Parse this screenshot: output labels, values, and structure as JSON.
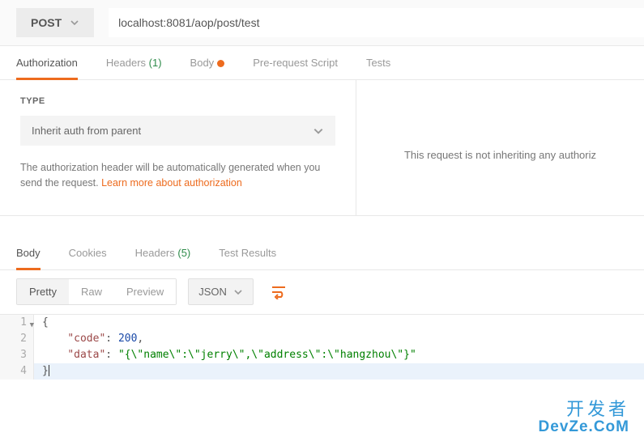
{
  "request": {
    "method": "POST",
    "url": "localhost:8081/aop/post/test"
  },
  "request_tabs": {
    "authorization": "Authorization",
    "headers": {
      "label": "Headers",
      "count": "(1)"
    },
    "body": "Body",
    "prerequest": "Pre-request Script",
    "tests": "Tests"
  },
  "auth": {
    "type_label": "TYPE",
    "selected": "Inherit auth from parent",
    "description_prefix": "The authorization header will be automatically generated when you send the request. ",
    "learn_more": "Learn more about authorization",
    "right_message": "This request is not inheriting any authoriz"
  },
  "response_tabs": {
    "body": "Body",
    "cookies": "Cookies",
    "headers": {
      "label": "Headers",
      "count": "(5)"
    },
    "test_results": "Test Results"
  },
  "body_toolbar": {
    "pretty": "Pretty",
    "raw": "Raw",
    "preview": "Preview",
    "format": "JSON"
  },
  "response_body": {
    "lines": [
      {
        "n": "1",
        "html": "<span class='tok-punc'>{</span>"
      },
      {
        "n": "2",
        "html": "    <span class='tok-key'>\"code\"</span><span class='tok-punc'>:</span> <span class='tok-num'>200</span><span class='tok-punc'>,</span>"
      },
      {
        "n": "3",
        "html": "    <span class='tok-key'>\"data\"</span><span class='tok-punc'>:</span> <span class='tok-str'>\"{\\\"name\\\":\\\"jerry\\\",\\\"address\\\":\\\"hangzhou\\\"}\"</span>"
      },
      {
        "n": "4",
        "html": "<span class='tok-punc'>}</span><span class='cursor'></span>"
      }
    ]
  },
  "watermark": {
    "top": "开发者",
    "bottom": "DevZe.CoM"
  },
  "colors": {
    "accent": "#ed6b1e",
    "green": "#2e8b4a"
  }
}
